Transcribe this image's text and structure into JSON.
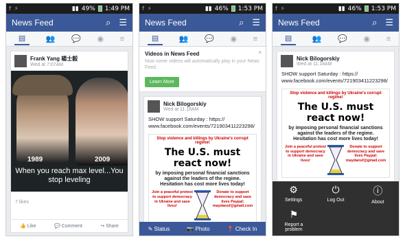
{
  "screens": [
    {
      "status": {
        "time": "1:49 PM",
        "battery": "49%"
      },
      "header": {
        "title": "News Feed"
      },
      "post": {
        "author": "Frank Yang 楊士毅",
        "time": "Wed at 7:07AM",
        "meme_year_left": "1989",
        "meme_year_right": "2009",
        "caption": "When you reach max level...You stop leveling",
        "likes": "7 likes",
        "actions": [
          "Like",
          "Comment",
          "Share"
        ]
      }
    },
    {
      "status": {
        "time": "1:53 PM",
        "battery": "46%"
      },
      "header": {
        "title": "News Feed"
      },
      "banner": {
        "title": "Videos in News Feed",
        "desc": "Now some videos will automatically play in your News Feed.",
        "button": "Learn More",
        "close": "×"
      },
      "post": {
        "author": "Nick Bilogorskiy",
        "time": "Wed at 11:18AM",
        "text": "SHOW support Saturday : https:// www.facebook.com/events/721903411223298/"
      },
      "poster": {
        "top": "Stop violence and killings by Ukraine's corrupt regime!",
        "headline": "The U.S. must react now!",
        "sub1": "by imposing personal financial sanctions against the leaders of the regime.",
        "sub2": "Hesitation has cost more lives today!",
        "left": "Join a peaceful protest to support democracy in Ukraine and save lives!",
        "right": "Donate to support democracy and save lives Paypal: maydansf@gmail.com"
      },
      "bottom": [
        "Status",
        "Photo",
        "Check In"
      ]
    },
    {
      "status": {
        "time": "1:53 PM",
        "battery": "46%"
      },
      "header": {
        "title": "News Feed"
      },
      "post": {
        "author": "Nick Bilogorskiy",
        "time": "Wed at 11:18AM",
        "text": "SHOW support Saturday : https:// www.facebook.com/events/721903411223298/"
      },
      "poster": {
        "top": "Stop violence and killings by Ukraine's corrupt regime!",
        "headline": "The U.S. must react now!",
        "sub1": "by imposing personal financial sanctions against the leaders of the regime.",
        "sub2": "Hesitation has cost more lives today!",
        "left": "Join a peaceful protest to support democracy in Ukraine and save lives!",
        "right": "Donate to support democracy and save lives Paypal: maydansf@gmail.com"
      },
      "menu": [
        "Settings",
        "Log Out",
        "About",
        "Report a problem"
      ]
    }
  ]
}
